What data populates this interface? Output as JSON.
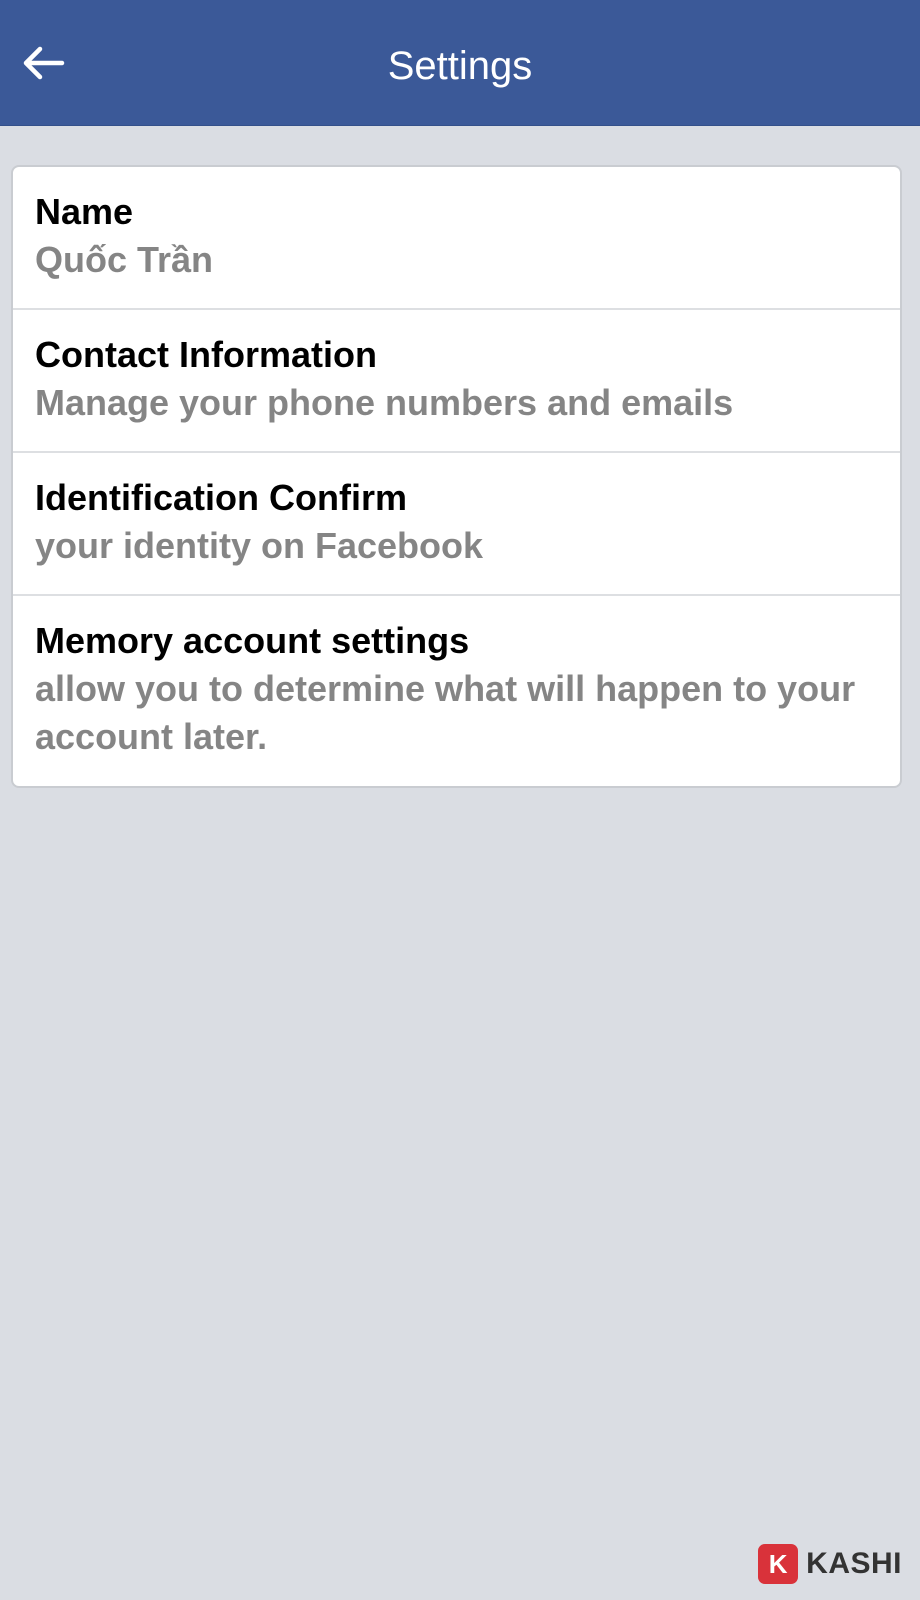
{
  "header": {
    "title": "Settings",
    "back_icon": "arrow-left-icon",
    "background_color": "#3b5998"
  },
  "settings": {
    "items": [
      {
        "title": "Name",
        "subtitle": "Quốc Trần"
      },
      {
        "title": "Contact Information",
        "subtitle": "Manage your phone numbers and emails"
      },
      {
        "title": "Identification Confirm",
        "subtitle": "your identity on Facebook"
      },
      {
        "title": "Memory account settings",
        "subtitle": "allow you to determine what will happen to your account later."
      }
    ]
  },
  "watermark": {
    "badge": "K",
    "text": "KASHI",
    "badge_color": "#d9323a"
  }
}
